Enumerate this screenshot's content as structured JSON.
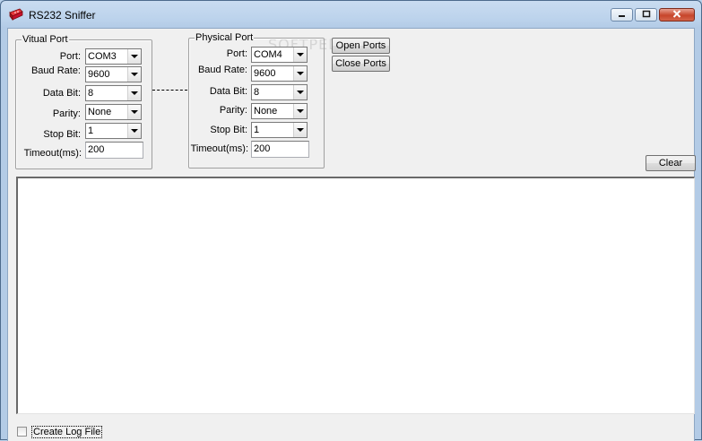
{
  "window": {
    "title": "RS232 Sniffer"
  },
  "virtual_port": {
    "title": "Vitual Port",
    "port_label": "Port:",
    "port_value": "COM3",
    "baud_label": "Baud Rate:",
    "baud_value": "9600",
    "databit_label": "Data Bit:",
    "databit_value": "8",
    "parity_label": "Parity:",
    "parity_value": "None",
    "stopbit_label": "Stop Bit:",
    "stopbit_value": "1",
    "timeout_label": "Timeout(ms):",
    "timeout_value": "200"
  },
  "physical_port": {
    "title": "Physical Port",
    "port_label": "Port:",
    "port_value": "COM4",
    "baud_label": "Baud Rate:",
    "baud_value": "9600",
    "databit_label": "Data Bit:",
    "databit_value": "8",
    "parity_label": "Parity:",
    "parity_value": "None",
    "stopbit_label": "Stop Bit:",
    "stopbit_value": "1",
    "timeout_label": "Timeout(ms):",
    "timeout_value": "200"
  },
  "buttons": {
    "open_ports": "Open Ports",
    "close_ports": "Close Ports",
    "clear": "Clear"
  },
  "log": {
    "create_log_label": "Create Log File",
    "checked": false
  },
  "colors": {
    "accent_icon": "#c8102e",
    "title_bar": "#bcd3ec",
    "client_bg": "#f0f0f0"
  },
  "icons": {
    "app": "rs232-connector-icon",
    "minimize": "minimize-icon",
    "maximize": "maximize-icon",
    "close": "close-icon"
  }
}
